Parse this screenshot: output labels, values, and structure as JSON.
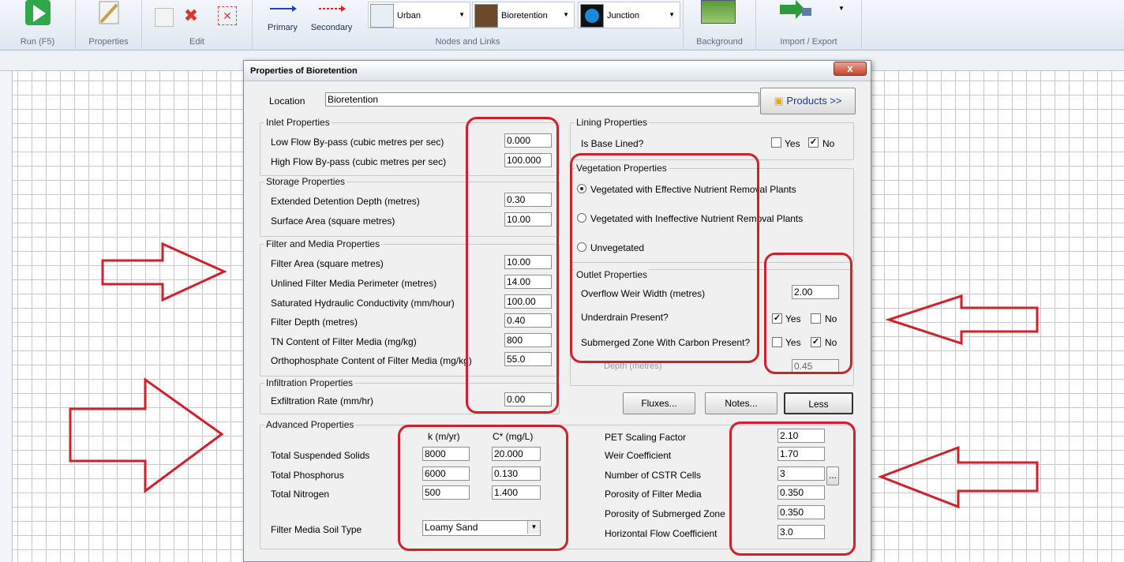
{
  "ribbon": {
    "run_label": "Run (F5)",
    "properties_label": "Properties",
    "edit_label": "Edit",
    "primary_label": "Primary",
    "secondary_label": "Secondary",
    "nodes_links_label": "Nodes and Links",
    "node_types": [
      "Urban",
      "Bioretention",
      "Junction"
    ],
    "background_label": "Background",
    "import_export_label": "Import / Export"
  },
  "dialog": {
    "title": "Properties of Bioretention",
    "close_label": "x",
    "location_label": "Location",
    "location_value": "Bioretention",
    "products_label": "Products >>",
    "inlet": {
      "title": "Inlet Properties",
      "low_flow_label": "Low Flow By-pass (cubic metres per sec)",
      "low_flow_value": "0.000",
      "high_flow_label": "High Flow By-pass (cubic metres per sec)",
      "high_flow_value": "100.000"
    },
    "storage": {
      "title": "Storage Properties",
      "edd_label": "Extended Detention Depth (metres)",
      "edd_value": "0.30",
      "surface_label": "Surface Area (square metres)",
      "surface_value": "10.00"
    },
    "filter": {
      "title": "Filter and Media Properties",
      "area_label": "Filter Area (square metres)",
      "area_value": "10.00",
      "perimeter_label": "Unlined Filter Media Perimeter (metres)",
      "perimeter_value": "14.00",
      "conductivity_label": "Saturated Hydraulic Conductivity (mm/hour)",
      "conductivity_value": "100.00",
      "depth_label": "Filter Depth (metres)",
      "depth_value": "0.40",
      "tn_label": "TN Content of Filter Media (mg/kg)",
      "tn_value": "800",
      "ortho_label": "Orthophosphate Content of Filter Media (mg/kg)",
      "ortho_value": "55.0"
    },
    "infiltration": {
      "title": "Infiltration Properties",
      "exfil_label": "Exfiltration Rate (mm/hr)",
      "exfil_value": "0.00"
    },
    "lining": {
      "title": "Lining Properties",
      "base_lined_label": "Is Base Lined?",
      "yes_label": "Yes",
      "no_label": "No"
    },
    "vegetation": {
      "title": "Vegetation Properties",
      "opt1": "Vegetated with Effective Nutrient Removal Plants",
      "opt2": "Vegetated with Ineffective Nutrient Removal Plants",
      "opt3": "Unvegetated"
    },
    "outlet": {
      "title": "Outlet Properties",
      "weir_width_label": "Overflow Weir Width (metres)",
      "weir_width_value": "2.00",
      "underdrain_label": "Underdrain Present?",
      "submerged_label": "Submerged Zone With Carbon Present?",
      "yes_label": "Yes",
      "no_label": "No",
      "depth_label": "Depth (metres)",
      "depth_value": "0.45"
    },
    "buttons": {
      "fluxes": "Fluxes...",
      "notes": "Notes...",
      "less": "Less"
    },
    "advanced": {
      "title": "Advanced Properties",
      "k_header": "k (m/yr)",
      "c_header": "C* (mg/L)",
      "rows": [
        {
          "label": "Total Suspended Solids",
          "k": "8000",
          "c": "20.000"
        },
        {
          "label": "Total Phosphorus",
          "k": "6000",
          "c": "0.130"
        },
        {
          "label": "Total Nitrogen",
          "k": "500",
          "c": "1.400"
        }
      ],
      "soil_label": "Filter Media Soil Type",
      "soil_value": "Loamy Sand",
      "pet_label": "PET Scaling Factor",
      "pet_value": "2.10",
      "weir_coef_label": "Weir Coefficient",
      "weir_coef_value": "1.70",
      "cstr_label": "Number of CSTR Cells",
      "cstr_value": "3",
      "cstr_btn": "...",
      "porosity_filter_label": "Porosity of Filter Media",
      "porosity_filter_value": "0.350",
      "porosity_sub_label": "Porosity of Submerged Zone",
      "porosity_sub_value": "0.350",
      "hflow_label": "Horizontal Flow Coefficient",
      "hflow_value": "3.0"
    }
  },
  "colors": {
    "annotation_red": "#d0202b",
    "dialog_bg": "#f0f0f0",
    "grid_line": "#c8c8c8"
  }
}
